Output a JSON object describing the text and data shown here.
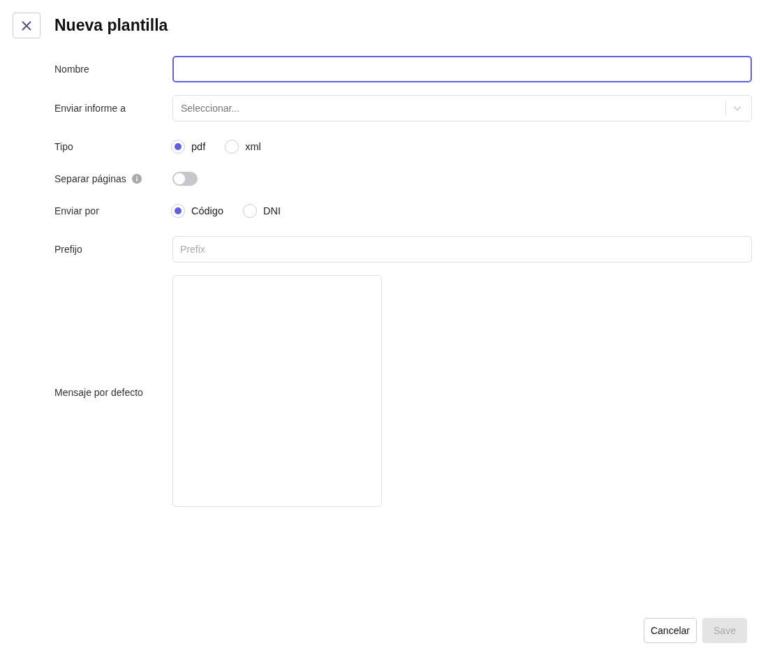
{
  "header": {
    "title": "Nueva plantilla"
  },
  "fields": [
    {
      "kind": "text",
      "label": "Nombre",
      "focused": true
    },
    {
      "kind": "select",
      "label": "Enviar informe a",
      "placeholder": "Seleccionar..."
    },
    {
      "kind": "radio",
      "label": "Tipo",
      "options": [
        {
          "label": "pdf",
          "selected": true
        },
        {
          "label": "xml",
          "selected": false
        }
      ]
    },
    {
      "kind": "toggle",
      "label": "Separar páginas",
      "info": true,
      "on": false
    },
    {
      "kind": "radio",
      "label": "Enviar por",
      "options": [
        {
          "label": "Código",
          "selected": true
        },
        {
          "label": "DNI",
          "selected": false
        }
      ]
    },
    {
      "kind": "text",
      "label": "Prefijo",
      "placeholder": "Prefix",
      "focused": false
    },
    {
      "kind": "textarea",
      "label": "Mensaje por defecto"
    }
  ],
  "footer": {
    "buttons": [
      {
        "label": "Cancelar",
        "disabled": false
      },
      {
        "label": "Save",
        "disabled": true
      }
    ]
  }
}
